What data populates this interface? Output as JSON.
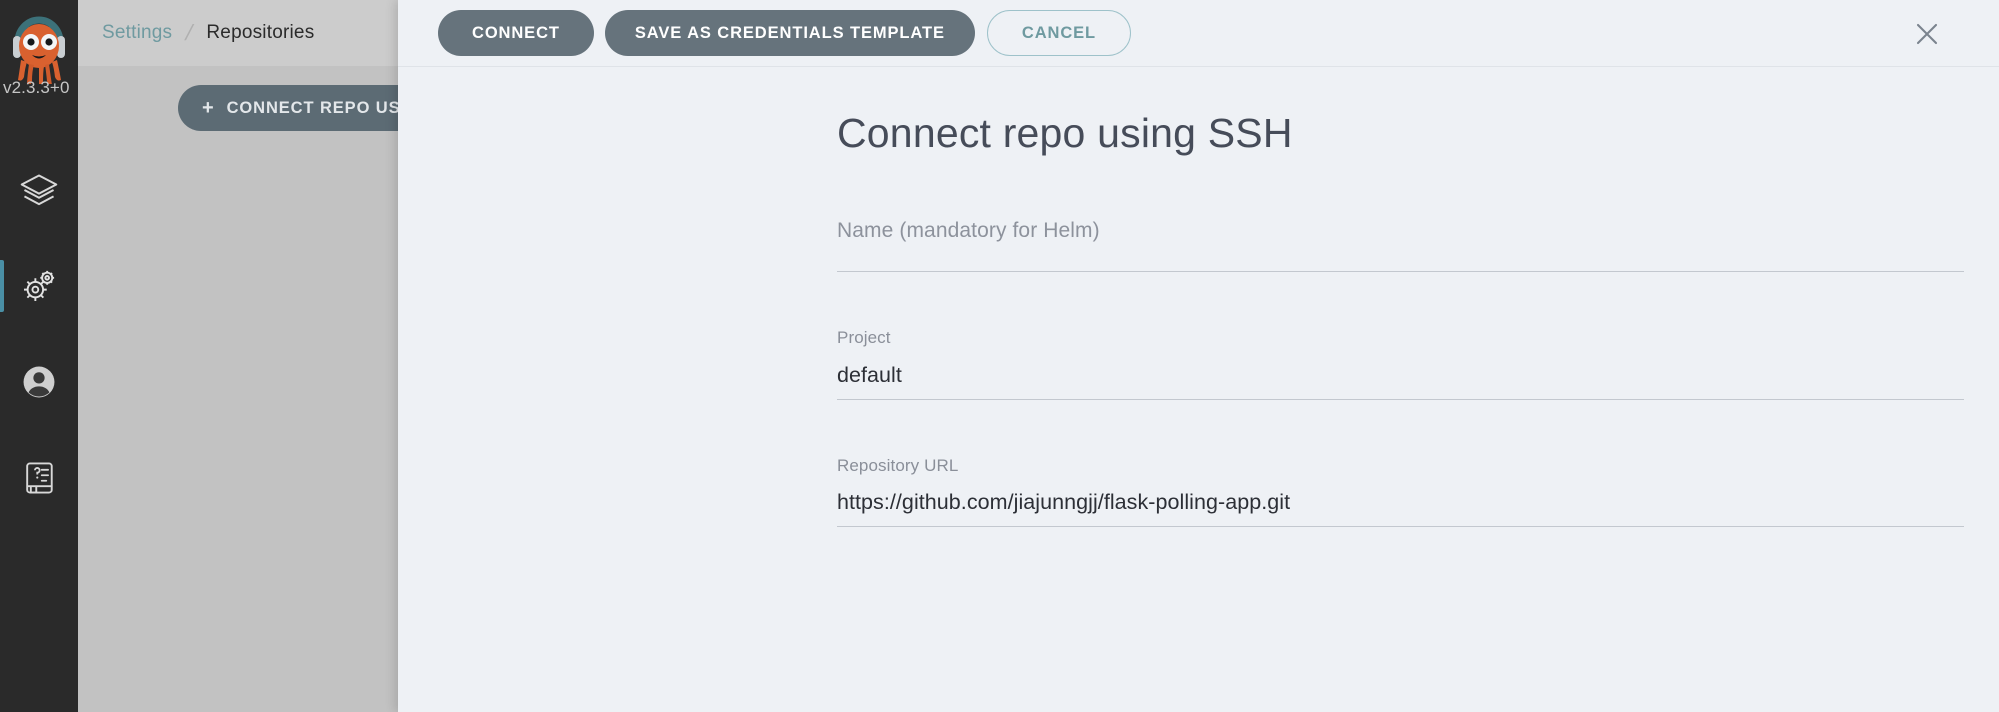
{
  "nav": {
    "logo_name": "argo-cd-octopus-logo",
    "version": "v2.3.3+0",
    "items": [
      {
        "name": "applications",
        "icon": "layers-icon",
        "active": false
      },
      {
        "name": "settings",
        "icon": "gear-icon",
        "active": true
      },
      {
        "name": "user-info",
        "icon": "user-circle-icon",
        "active": false
      },
      {
        "name": "documentation",
        "icon": "help-book-icon",
        "active": false
      }
    ]
  },
  "background": {
    "breadcrumb": {
      "parent": "Settings",
      "separator": "/",
      "current": "Repositories"
    },
    "connect_repo_button": {
      "plus": "+",
      "label": "CONNECT REPO USING SSH"
    },
    "repo_tiles": [
      {
        "icon": "git-icon"
      },
      {
        "icon": "git-icon"
      }
    ]
  },
  "panel": {
    "toolbar": {
      "connect_label": "CONNECT",
      "save_template_label": "SAVE AS CREDENTIALS TEMPLATE",
      "cancel_label": "CANCEL",
      "close_icon": "close-icon"
    },
    "title": "Connect repo using SSH",
    "fields": [
      {
        "label": "Name (mandatory for Helm)",
        "value": "",
        "is_placeholder": true
      },
      {
        "label": "Project",
        "value": "default",
        "is_placeholder": false
      },
      {
        "label": "Repository URL",
        "value": "https://github.com/jiajunngjj/flask-polling-app.git",
        "is_placeholder": false
      }
    ]
  },
  "colors": {
    "panel_bg": "#eef1f5",
    "nav_bg": "#2a2a2a",
    "accent_teal": "#6f9aa0",
    "button_gray": "#66737c",
    "active_indicator": "#4a8fa5"
  }
}
